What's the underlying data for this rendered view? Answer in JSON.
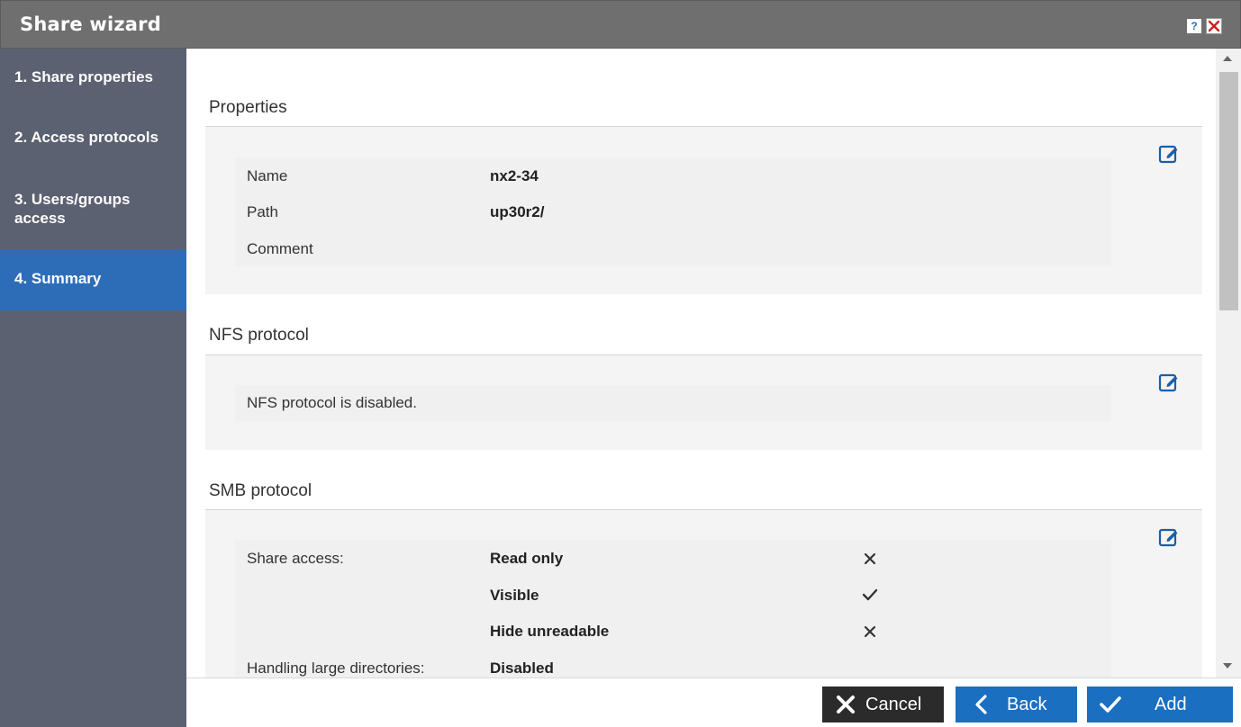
{
  "window": {
    "title": "Share wizard",
    "help_label": "?"
  },
  "sidebar": {
    "items": [
      {
        "label": "1. Share properties"
      },
      {
        "label": "2. Access protocols"
      },
      {
        "label": "3. Users/groups access"
      },
      {
        "label": "4. Summary",
        "active": true
      }
    ]
  },
  "properties": {
    "title": "Properties",
    "rows": [
      {
        "label": "Name",
        "value": "nx2-34"
      },
      {
        "label": "Path",
        "value": "up30r2/"
      },
      {
        "label": "Comment",
        "value": ""
      }
    ]
  },
  "nfs": {
    "title": "NFS protocol",
    "status": "NFS protocol is disabled."
  },
  "smb": {
    "title": "SMB protocol",
    "share_access_label": "Share access:",
    "options": [
      {
        "label": "Read only",
        "enabled": false,
        "icon": "cross-icon"
      },
      {
        "label": "Visible",
        "enabled": true,
        "icon": "check-icon"
      },
      {
        "label": "Hide unreadable",
        "enabled": false,
        "icon": "cross-icon"
      }
    ],
    "large_dirs_label": "Handling large directories:",
    "large_dirs_value": "Disabled"
  },
  "footer": {
    "cancel_label": "Cancel",
    "back_label": "Back",
    "add_label": "Add"
  },
  "colors": {
    "accent": "#1a6fc0",
    "sidebar": "#5b6170",
    "sidebar_active": "#2d6db8",
    "titlebar": "#6f6f6f",
    "cancel": "#2b2b2b",
    "edit_icon": "#1a5fa8"
  }
}
